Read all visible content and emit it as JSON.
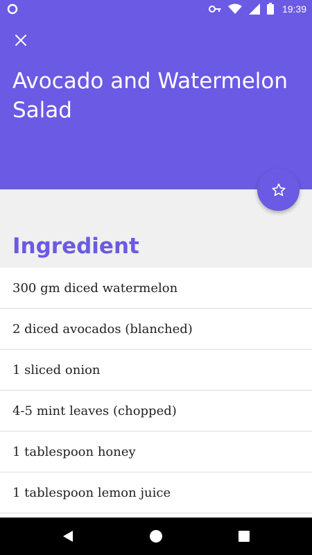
{
  "status_bar": {
    "time": "19:39",
    "icons": [
      "app-notification-icon",
      "vpn-key-icon",
      "wifi-icon",
      "signal-icon",
      "battery-icon"
    ]
  },
  "header": {
    "title": "Avocado and Watermelon Salad",
    "close_icon": "close-icon",
    "background_color": "#6b5ae3"
  },
  "fab": {
    "icon": "star-outline-icon"
  },
  "ingredients": {
    "title": "Ingredient",
    "items": [
      "300 gm diced watermelon",
      "2 diced avocados (blanched)",
      "1 sliced onion",
      "4-5 mint leaves (chopped)",
      "1 tablespoon honey",
      "1 tablespoon lemon juice"
    ]
  },
  "nav_bar": {
    "icons": [
      "back-icon",
      "home-icon",
      "recents-icon"
    ]
  },
  "colors": {
    "accent": "#6b5ae3",
    "page_background": "#f0f0f0"
  }
}
